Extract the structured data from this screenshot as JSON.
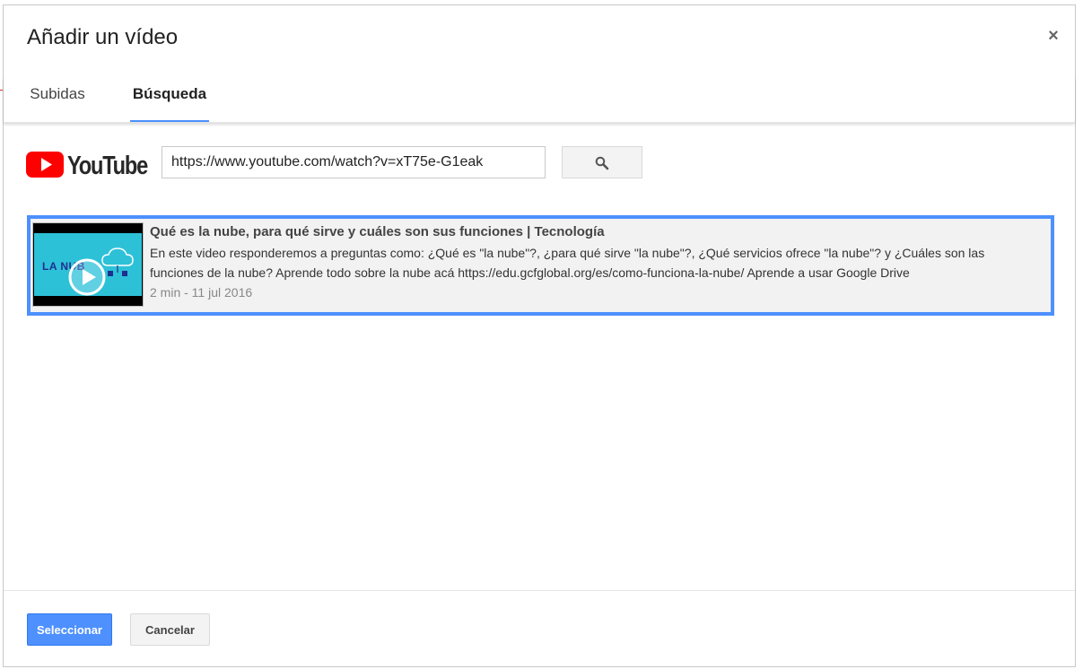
{
  "dialog": {
    "title": "Añadir un vídeo",
    "close_label": "×"
  },
  "tabs": [
    {
      "label": "Subidas",
      "active": false
    },
    {
      "label": "Búsqueda",
      "active": true
    }
  ],
  "search": {
    "logo": "youtube-logo",
    "logo_text": "YouTube",
    "value": "https://www.youtube.com/watch?v=xT75e-G1eak",
    "button_icon": "search-icon"
  },
  "results": [
    {
      "title": "Qué es la nube, para qué sirve y cuáles son sus funciones | Tecnología",
      "description": "En este video responderemos a preguntas como: ¿Qué es \"la nube\"?, ¿para qué sirve \"la nube\"?, ¿Qué servicios ofrece \"la nube\"? y ¿Cuáles son las funciones de la nube? Aprende todo sobre la nube acá https://edu.gcfglobal.org/es/como-funciona-la-nube/ Aprende a usar Google Drive",
      "meta": "2 min - 11 jul 2016",
      "thumbnail_text": "LA NUB",
      "selected": true
    }
  ],
  "footer": {
    "select_label": "Seleccionar",
    "cancel_label": "Cancelar"
  },
  "colors": {
    "accent": "#4d90fe",
    "youtube_red": "#ff0000",
    "thumbnail_bg": "#2dc1d8"
  }
}
